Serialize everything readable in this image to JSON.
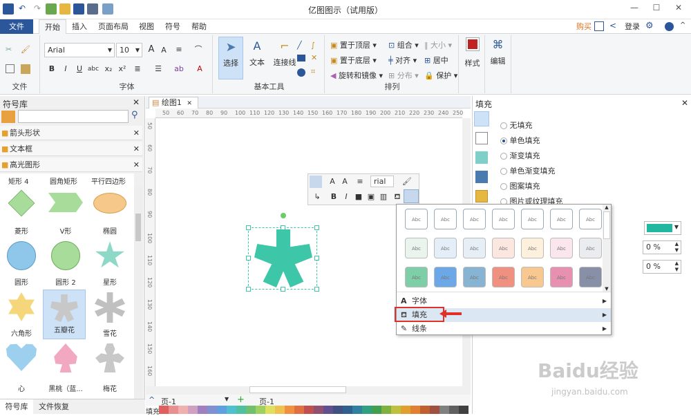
{
  "window": {
    "title": "亿图图示（试用版）"
  },
  "menu": {
    "file": "文件",
    "tabs": [
      "开始",
      "插入",
      "页面布局",
      "视图",
      "符号",
      "帮助"
    ],
    "right": {
      "buy": "购买",
      "login": "登录"
    }
  },
  "ribbon": {
    "file_group": "文件",
    "font_group": "字体",
    "font_name": "Arial",
    "font_size": "10",
    "tools_group": "基本工具",
    "select_label": "选择",
    "text_label": "文本",
    "connector_label": "连接线",
    "arrange_group": "排列",
    "bring_front": "置于顶层",
    "send_back": "置于底层",
    "rotate_mirror": "旋转和镜像",
    "group": "组合",
    "align": "对齐",
    "distribute": "分布",
    "size": "大小",
    "center": "居中",
    "protect": "保护",
    "style_label": "样式",
    "edit_label": "编辑"
  },
  "library": {
    "title": "符号库",
    "sections": [
      "箭头形状",
      "文本框",
      "高光图形"
    ],
    "header_labels": [
      "矩形 4",
      "圆角矩形",
      "平行四边形"
    ],
    "shapes": [
      {
        "label": "菱形",
        "color": "#a8dc9a"
      },
      {
        "label": "V形",
        "color": "#a8dc9a"
      },
      {
        "label": "椭圆",
        "color": "#f6c98a"
      },
      {
        "label": "圆形",
        "color": "#8ec7ea"
      },
      {
        "label": "圆形 2",
        "color": "#a8dc9a"
      },
      {
        "label": "星形",
        "color": "#8ed8c8"
      },
      {
        "label": "六角形",
        "color": "#f5d67a"
      },
      {
        "label": "五瓣花",
        "color": "#c8c8c8"
      },
      {
        "label": "雪花",
        "color": "#c0c0c0"
      },
      {
        "label": "心",
        "color": "#9cd0ee"
      },
      {
        "label": "黑桃（蓝...",
        "color": "#f2a8c0"
      },
      {
        "label": "梅花",
        "color": "#c8c8c8"
      }
    ],
    "bottom_tabs": [
      "符号库",
      "文件恢复"
    ]
  },
  "canvas": {
    "tab": "绘图1",
    "ruler_top": [
      "50",
      "60",
      "70",
      "80",
      "90",
      "100",
      "110",
      "120",
      "130",
      "140",
      "150",
      "160",
      "170",
      "180",
      "190",
      "200",
      "210",
      "220",
      "230",
      "240",
      "250"
    ],
    "ruler_left": [
      "50",
      "60",
      "70",
      "80",
      "90",
      "100",
      "110",
      "120",
      "130",
      "140",
      "150",
      "160"
    ],
    "shape_color": "#3ec6a8",
    "mini_font": "rial",
    "page_selector": "页-1",
    "page_tab": "页-1",
    "fill_label": "填充"
  },
  "context_menu": {
    "items": [
      "字体",
      "填充",
      "线条"
    ],
    "style_rows": [
      [
        "#ffffff",
        "#ffffff",
        "#ffffff",
        "#ffffff",
        "#ffffff",
        "#ffffff",
        "#ffffff"
      ],
      [
        "#e8f4ec",
        "#e4eef8",
        "#e6eef6",
        "#fbe6e0",
        "#fdf0dc",
        "#fbe6ee",
        "#eaecf0"
      ],
      [
        "#7ecfa8",
        "#6ca8e8",
        "#88b4d4",
        "#f09080",
        "#f8c890",
        "#e890b0",
        "#8890a8"
      ]
    ],
    "cell_text": "Abc"
  },
  "fill_panel": {
    "title": "填充",
    "options": [
      "无填充",
      "单色填充",
      "渐变填充",
      "单色渐变填充",
      "图案填充",
      "图片或纹理填充"
    ],
    "selected": "单色填充",
    "color": "#22b8a0",
    "percent1": "0 %",
    "percent2": "0 %"
  },
  "watermark": {
    "text": "Baidu经验",
    "url": "jingyan.baidu.com"
  }
}
